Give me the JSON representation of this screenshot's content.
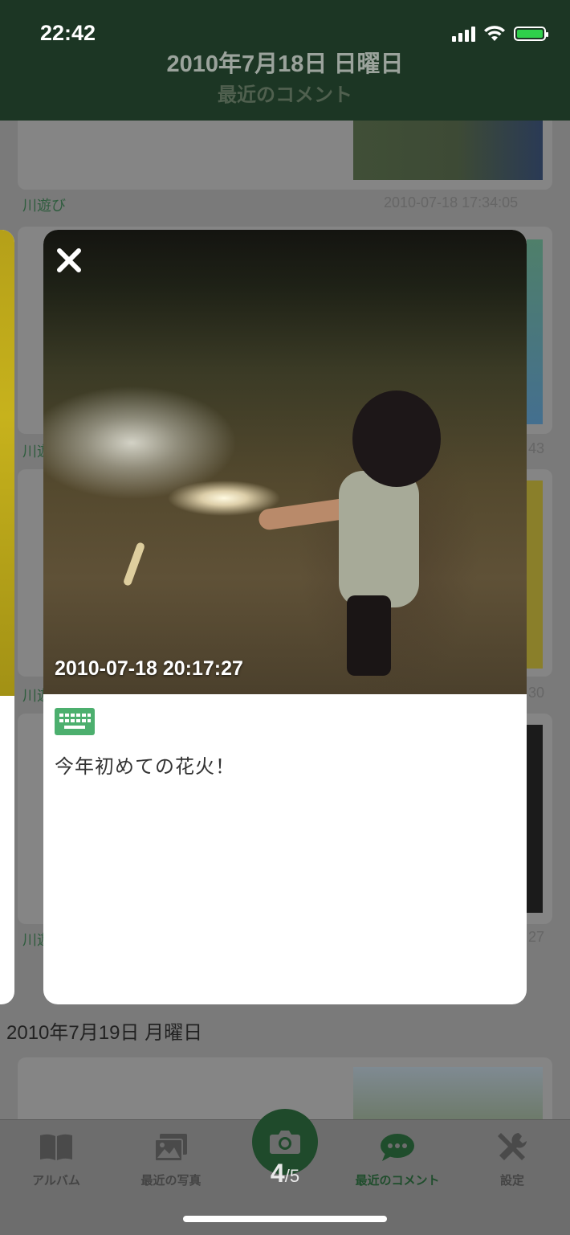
{
  "status_bar": {
    "time": "22:42"
  },
  "header": {
    "title": "2010年7月18日 日曜日",
    "subtitle": "最近のコメント"
  },
  "background_feed": {
    "items": [
      {
        "tag": "川遊び",
        "timestamp": "2010-07-18 17:34:05"
      },
      {
        "tag": "川遊",
        "timestamp": "43"
      },
      {
        "tag": "川遊",
        "timestamp": "30"
      },
      {
        "tag": "川遊",
        "timestamp": "27"
      }
    ],
    "next_day_heading": "2010年7月19日 月曜日"
  },
  "modal": {
    "photo_timestamp": "2010-07-18 20:17:27",
    "input_method_icon": "keyboard-icon",
    "comment": "今年初めての花火！",
    "close_icon": "close-icon"
  },
  "tabbar": {
    "tabs": [
      {
        "label": "アルバム",
        "icon": "album-icon"
      },
      {
        "label": "最近の写真",
        "icon": "photos-icon"
      },
      {
        "label": "最近のコメント",
        "icon": "comment-icon"
      },
      {
        "label": "設定",
        "icon": "settings-icon"
      }
    ],
    "camera_icon": "camera-icon"
  },
  "pager": {
    "current": "4",
    "total": "/5"
  },
  "colors": {
    "header_bg": "#1c3624",
    "accent_green": "#2e7d4a",
    "keyboard_icon": "#4caf6e"
  }
}
